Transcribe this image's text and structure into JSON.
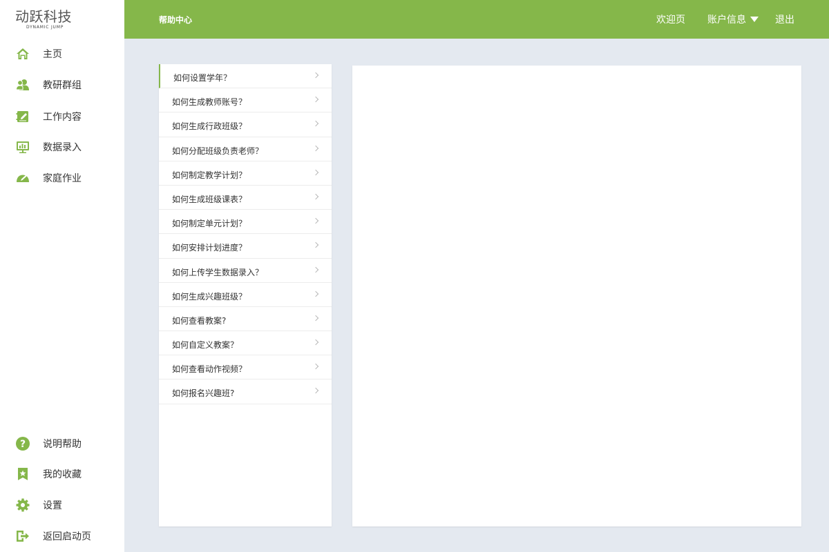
{
  "brand": {
    "name": "动跃科技",
    "tagline": "DYNAMIC JUMP"
  },
  "colors": {
    "accent": "#85b74a",
    "background": "#e4e9f0",
    "panel": "#ffffff"
  },
  "sidebar": {
    "top_items": [
      {
        "label": "主页",
        "icon": "home-icon"
      },
      {
        "label": "教研群组",
        "icon": "users-icon"
      },
      {
        "label": "工作内容",
        "icon": "edit-icon"
      },
      {
        "label": "数据录入",
        "icon": "monitor-chart-icon"
      },
      {
        "label": "家庭作业",
        "icon": "homework-icon"
      }
    ],
    "bottom_items": [
      {
        "label": "说明帮助",
        "icon": "help-icon"
      },
      {
        "label": "我的收藏",
        "icon": "bookmark-star-icon"
      },
      {
        "label": "设置",
        "icon": "gear-icon"
      },
      {
        "label": "返回启动页",
        "icon": "exit-icon"
      }
    ]
  },
  "header": {
    "title": "帮助中心",
    "welcome": "欢迎页",
    "account": "账户信息",
    "logout": "退出"
  },
  "questions": [
    "如何设置学年？",
    "如何生成教师账号？",
    "如何生成行政班级？",
    "如何分配班级负责老师？",
    "如何制定教学计划？",
    "如何生成班级课表？",
    "如何制定单元计划？",
    "如何安排计划进度？",
    "如何上传学生数据录入？",
    "如何生成兴趣班级？",
    "如何查看教案?",
    "如何自定义教案？",
    "如何查看动作视频？",
    "如何报名兴趣班?"
  ],
  "active_question_index": 0
}
